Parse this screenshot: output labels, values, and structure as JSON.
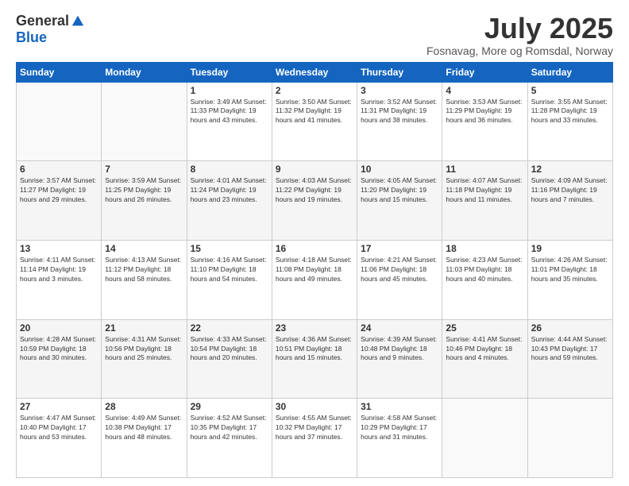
{
  "header": {
    "logo_general": "General",
    "logo_blue": "Blue",
    "month_title": "July 2025",
    "location": "Fosnavag, More og Romsdal, Norway"
  },
  "days_of_week": [
    "Sunday",
    "Monday",
    "Tuesday",
    "Wednesday",
    "Thursday",
    "Friday",
    "Saturday"
  ],
  "weeks": [
    [
      {
        "day": "",
        "info": ""
      },
      {
        "day": "",
        "info": ""
      },
      {
        "day": "1",
        "info": "Sunrise: 3:49 AM\nSunset: 11:33 PM\nDaylight: 19 hours and 43 minutes."
      },
      {
        "day": "2",
        "info": "Sunrise: 3:50 AM\nSunset: 11:32 PM\nDaylight: 19 hours and 41 minutes."
      },
      {
        "day": "3",
        "info": "Sunrise: 3:52 AM\nSunset: 11:31 PM\nDaylight: 19 hours and 38 minutes."
      },
      {
        "day": "4",
        "info": "Sunrise: 3:53 AM\nSunset: 11:29 PM\nDaylight: 19 hours and 36 minutes."
      },
      {
        "day": "5",
        "info": "Sunrise: 3:55 AM\nSunset: 11:28 PM\nDaylight: 19 hours and 33 minutes."
      }
    ],
    [
      {
        "day": "6",
        "info": "Sunrise: 3:57 AM\nSunset: 11:27 PM\nDaylight: 19 hours and 29 minutes."
      },
      {
        "day": "7",
        "info": "Sunrise: 3:59 AM\nSunset: 11:25 PM\nDaylight: 19 hours and 26 minutes."
      },
      {
        "day": "8",
        "info": "Sunrise: 4:01 AM\nSunset: 11:24 PM\nDaylight: 19 hours and 23 minutes."
      },
      {
        "day": "9",
        "info": "Sunrise: 4:03 AM\nSunset: 11:22 PM\nDaylight: 19 hours and 19 minutes."
      },
      {
        "day": "10",
        "info": "Sunrise: 4:05 AM\nSunset: 11:20 PM\nDaylight: 19 hours and 15 minutes."
      },
      {
        "day": "11",
        "info": "Sunrise: 4:07 AM\nSunset: 11:18 PM\nDaylight: 19 hours and 11 minutes."
      },
      {
        "day": "12",
        "info": "Sunrise: 4:09 AM\nSunset: 11:16 PM\nDaylight: 19 hours and 7 minutes."
      }
    ],
    [
      {
        "day": "13",
        "info": "Sunrise: 4:11 AM\nSunset: 11:14 PM\nDaylight: 19 hours and 3 minutes."
      },
      {
        "day": "14",
        "info": "Sunrise: 4:13 AM\nSunset: 11:12 PM\nDaylight: 18 hours and 58 minutes."
      },
      {
        "day": "15",
        "info": "Sunrise: 4:16 AM\nSunset: 11:10 PM\nDaylight: 18 hours and 54 minutes."
      },
      {
        "day": "16",
        "info": "Sunrise: 4:18 AM\nSunset: 11:08 PM\nDaylight: 18 hours and 49 minutes."
      },
      {
        "day": "17",
        "info": "Sunrise: 4:21 AM\nSunset: 11:06 PM\nDaylight: 18 hours and 45 minutes."
      },
      {
        "day": "18",
        "info": "Sunrise: 4:23 AM\nSunset: 11:03 PM\nDaylight: 18 hours and 40 minutes."
      },
      {
        "day": "19",
        "info": "Sunrise: 4:26 AM\nSunset: 11:01 PM\nDaylight: 18 hours and 35 minutes."
      }
    ],
    [
      {
        "day": "20",
        "info": "Sunrise: 4:28 AM\nSunset: 10:59 PM\nDaylight: 18 hours and 30 minutes."
      },
      {
        "day": "21",
        "info": "Sunrise: 4:31 AM\nSunset: 10:56 PM\nDaylight: 18 hours and 25 minutes."
      },
      {
        "day": "22",
        "info": "Sunrise: 4:33 AM\nSunset: 10:54 PM\nDaylight: 18 hours and 20 minutes."
      },
      {
        "day": "23",
        "info": "Sunrise: 4:36 AM\nSunset: 10:51 PM\nDaylight: 18 hours and 15 minutes."
      },
      {
        "day": "24",
        "info": "Sunrise: 4:39 AM\nSunset: 10:48 PM\nDaylight: 18 hours and 9 minutes."
      },
      {
        "day": "25",
        "info": "Sunrise: 4:41 AM\nSunset: 10:46 PM\nDaylight: 18 hours and 4 minutes."
      },
      {
        "day": "26",
        "info": "Sunrise: 4:44 AM\nSunset: 10:43 PM\nDaylight: 17 hours and 59 minutes."
      }
    ],
    [
      {
        "day": "27",
        "info": "Sunrise: 4:47 AM\nSunset: 10:40 PM\nDaylight: 17 hours and 53 minutes."
      },
      {
        "day": "28",
        "info": "Sunrise: 4:49 AM\nSunset: 10:38 PM\nDaylight: 17 hours and 48 minutes."
      },
      {
        "day": "29",
        "info": "Sunrise: 4:52 AM\nSunset: 10:35 PM\nDaylight: 17 hours and 42 minutes."
      },
      {
        "day": "30",
        "info": "Sunrise: 4:55 AM\nSunset: 10:32 PM\nDaylight: 17 hours and 37 minutes."
      },
      {
        "day": "31",
        "info": "Sunrise: 4:58 AM\nSunset: 10:29 PM\nDaylight: 17 hours and 31 minutes."
      },
      {
        "day": "",
        "info": ""
      },
      {
        "day": "",
        "info": ""
      }
    ]
  ]
}
